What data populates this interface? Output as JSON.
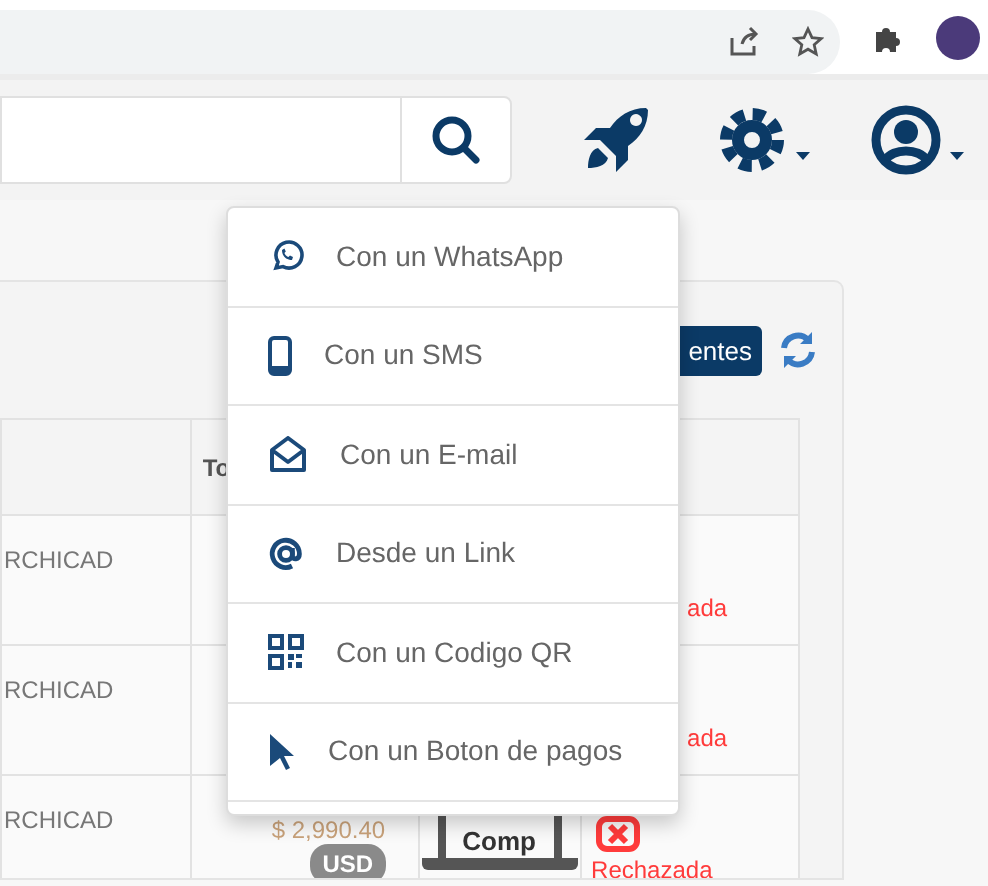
{
  "toolbar": {
    "button_label": "entes"
  },
  "table": {
    "header": {
      "column_2": "To"
    },
    "rows": [
      {
        "column_1": "RCHICAD",
        "status": "ada"
      },
      {
        "column_1": "RCHICAD",
        "status": "ada"
      },
      {
        "column_1": "RCHICAD",
        "amount": "$ 2,990.40",
        "currency": "USD",
        "document": "Comp",
        "status": "Rechazada"
      }
    ]
  },
  "menu": {
    "items": [
      {
        "kind": "whatsapp",
        "label": "Con un WhatsApp"
      },
      {
        "kind": "sms",
        "label": "Con un SMS"
      },
      {
        "kind": "email",
        "label": "Con un E-mail"
      },
      {
        "kind": "link",
        "label": "Desde un Link"
      },
      {
        "kind": "qr",
        "label": "Con un Codigo QR"
      },
      {
        "kind": "button",
        "label": "Con un Boton de pagos"
      }
    ]
  }
}
